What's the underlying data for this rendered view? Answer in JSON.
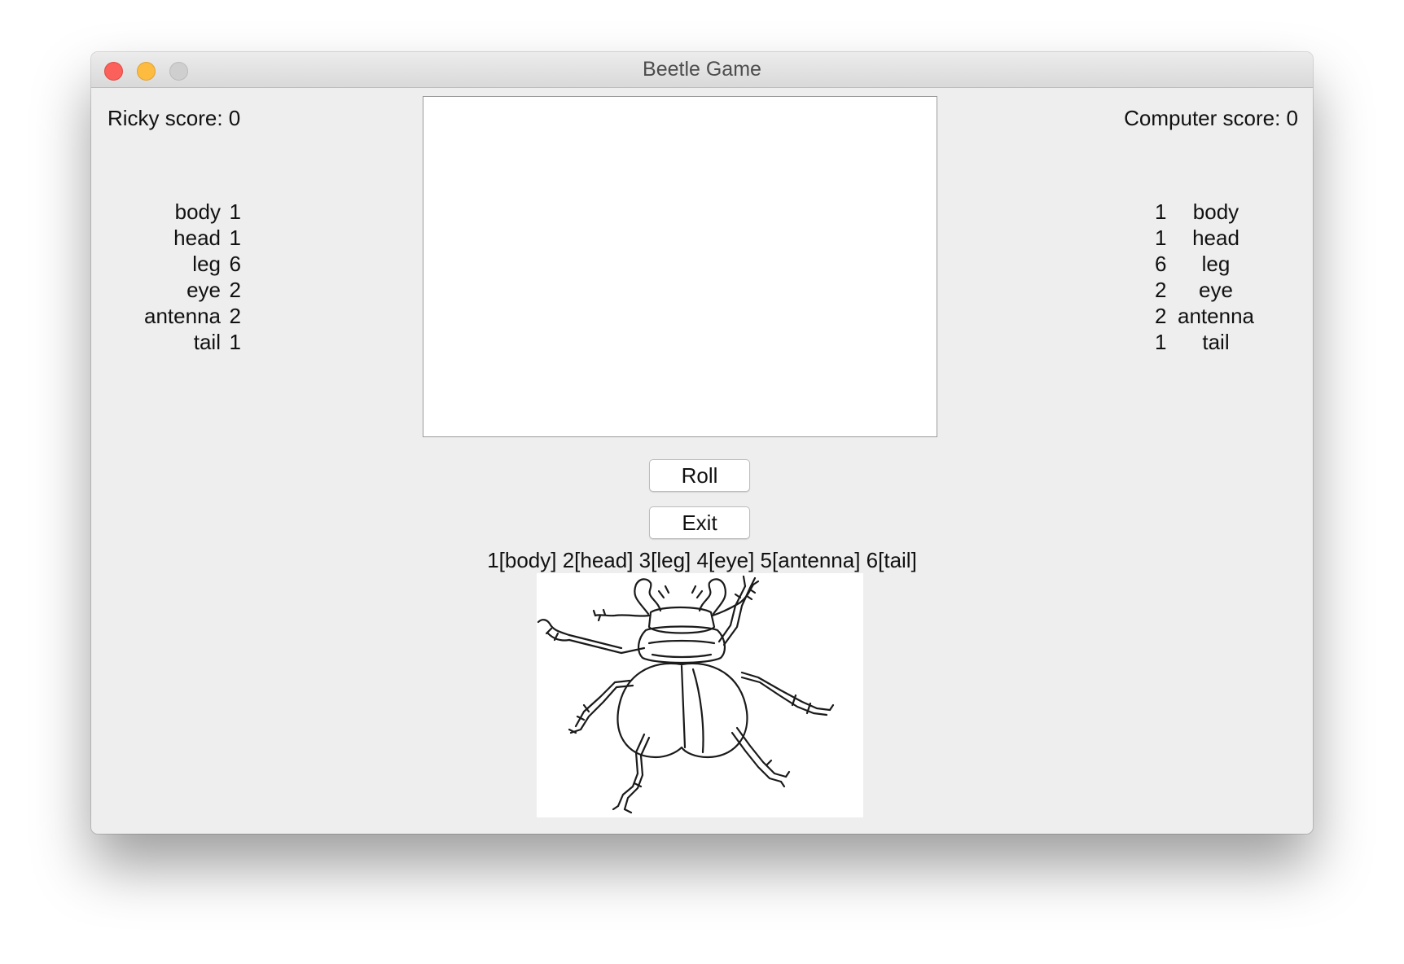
{
  "window": {
    "title": "Beetle Game"
  },
  "player": {
    "score_label": "Ricky score: 0",
    "parts": [
      {
        "name": "body",
        "count": "1"
      },
      {
        "name": "head",
        "count": "1"
      },
      {
        "name": "leg",
        "count": "6"
      },
      {
        "name": "eye",
        "count": "2"
      },
      {
        "name": "antenna",
        "count": "2"
      },
      {
        "name": "tail",
        "count": "1"
      }
    ]
  },
  "computer": {
    "score_label": "Computer score: 0",
    "parts": [
      {
        "count": "1",
        "name": "body"
      },
      {
        "count": "1",
        "name": "head"
      },
      {
        "count": "6",
        "name": "leg"
      },
      {
        "count": "2",
        "name": "eye"
      },
      {
        "count": "2",
        "name": "antenna"
      },
      {
        "count": "1",
        "name": "tail"
      }
    ]
  },
  "controls": {
    "roll_label": "Roll",
    "exit_label": "Exit"
  },
  "legend": "1[body] 2[head] 3[leg] 4[eye] 5[antenna] 6[tail]",
  "image": {
    "subject": "stag-beetle-line-drawing"
  }
}
